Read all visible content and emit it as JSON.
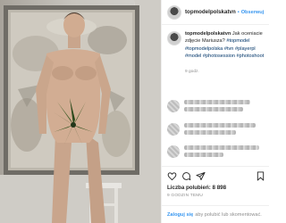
{
  "post": {
    "photo_icon": "photo",
    "username": "topmodelpolskatvn",
    "follow_separator": "•",
    "follow_label": "Obserwuj",
    "caption_user": "topmodelpolskatvn",
    "caption_text": "Jak oceniacie zdjęcie Mariusza?",
    "hashtags": "#topmodel #topmodelpolska #tvn #playerpl #model #photosession #photoshoot",
    "age": "9 godz.",
    "likes_label": "Liczba polubień: 8 898",
    "date": "9 GODZIN TEMU"
  },
  "footer": {
    "login_link": "Zaloguj się",
    "login_rest": "aby polubić lub skomentować."
  },
  "icons": {
    "avatar": "profile-avatar",
    "like": "heart-icon",
    "comment": "comment-icon",
    "share": "share-icon",
    "save": "bookmark-icon"
  },
  "colors": {
    "link_blue": "#3897f0",
    "hashtag_blue": "#003569",
    "muted_grey": "#8e8e8e",
    "border": "#efefef"
  }
}
